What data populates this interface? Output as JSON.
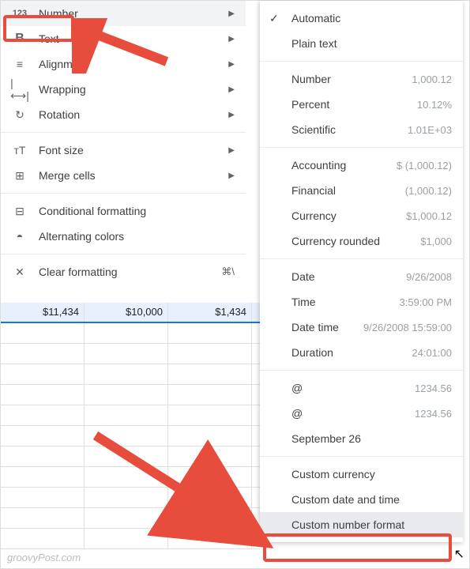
{
  "leftMenu": {
    "group1": [
      {
        "icon": "123",
        "label": "Number",
        "hasSubmenu": true,
        "highlighted": true,
        "dataName": "menu-number",
        "iconName": "number-icon"
      },
      {
        "icon": "B",
        "label": "Text",
        "hasSubmenu": true,
        "dataName": "menu-text",
        "iconName": "bold-icon"
      },
      {
        "icon": "≡",
        "label": "Alignment",
        "hasSubmenu": true,
        "dataName": "menu-alignment",
        "iconName": "align-icon"
      },
      {
        "icon": "|⟷|",
        "label": "Wrapping",
        "hasSubmenu": true,
        "dataName": "menu-wrapping",
        "iconName": "wrap-icon"
      },
      {
        "icon": "↻",
        "label": "Rotation",
        "hasSubmenu": true,
        "dataName": "menu-rotation",
        "iconName": "rotation-icon"
      }
    ],
    "group2": [
      {
        "icon": "тT",
        "label": "Font size",
        "hasSubmenu": true,
        "dataName": "menu-font-size",
        "iconName": "font-size-icon"
      },
      {
        "icon": "⊞",
        "label": "Merge cells",
        "hasSubmenu": true,
        "dataName": "menu-merge-cells",
        "iconName": "merge-icon"
      }
    ],
    "group3": [
      {
        "icon": "⊟",
        "label": "Conditional formatting",
        "dataName": "menu-conditional-formatting",
        "iconName": "conditional-icon"
      },
      {
        "icon": "◓",
        "label": "Alternating colors",
        "dataName": "menu-alternating-colors",
        "iconName": "alternating-icon"
      }
    ],
    "group4": [
      {
        "icon": "✕",
        "label": "Clear formatting",
        "shortcut": "⌘\\",
        "dataName": "menu-clear-formatting",
        "iconName": "clear-icon"
      }
    ]
  },
  "submenu": {
    "group1": [
      {
        "label": "Automatic",
        "checked": true,
        "dataName": "fmt-automatic"
      },
      {
        "label": "Plain text",
        "dataName": "fmt-plain-text"
      }
    ],
    "group2": [
      {
        "label": "Number",
        "example": "1,000.12",
        "dataName": "fmt-number"
      },
      {
        "label": "Percent",
        "example": "10.12%",
        "dataName": "fmt-percent"
      },
      {
        "label": "Scientific",
        "example": "1.01E+03",
        "dataName": "fmt-scientific"
      }
    ],
    "group3": [
      {
        "label": "Accounting",
        "example": "$ (1,000.12)",
        "dataName": "fmt-accounting"
      },
      {
        "label": "Financial",
        "example": "(1,000.12)",
        "dataName": "fmt-financial"
      },
      {
        "label": "Currency",
        "example": "$1,000.12",
        "dataName": "fmt-currency"
      },
      {
        "label": "Currency rounded",
        "example": "$1,000",
        "dataName": "fmt-currency-rounded"
      }
    ],
    "group4": [
      {
        "label": "Date",
        "example": "9/26/2008",
        "dataName": "fmt-date"
      },
      {
        "label": "Time",
        "example": "3:59:00 PM",
        "dataName": "fmt-time"
      },
      {
        "label": "Date time",
        "example": "9/26/2008 15:59:00",
        "dataName": "fmt-date-time"
      },
      {
        "label": "Duration",
        "example": "24:01:00",
        "dataName": "fmt-duration"
      }
    ],
    "group5": [
      {
        "label": "@",
        "example": "1234.56",
        "dataName": "fmt-at-1"
      },
      {
        "label": "@",
        "example": "1234.56",
        "dataName": "fmt-at-2"
      },
      {
        "label": "September 26",
        "dataName": "fmt-month-day"
      }
    ],
    "group6": [
      {
        "label": "Custom currency",
        "dataName": "fmt-custom-currency"
      },
      {
        "label": "Custom date and time",
        "dataName": "fmt-custom-date-time"
      },
      {
        "label": "Custom number format",
        "dataName": "fmt-custom-number-format",
        "selected": true
      }
    ]
  },
  "sheet": {
    "row": [
      "$11,434",
      "$10,000",
      "$1,434"
    ]
  },
  "watermark": "groovyPost.com"
}
